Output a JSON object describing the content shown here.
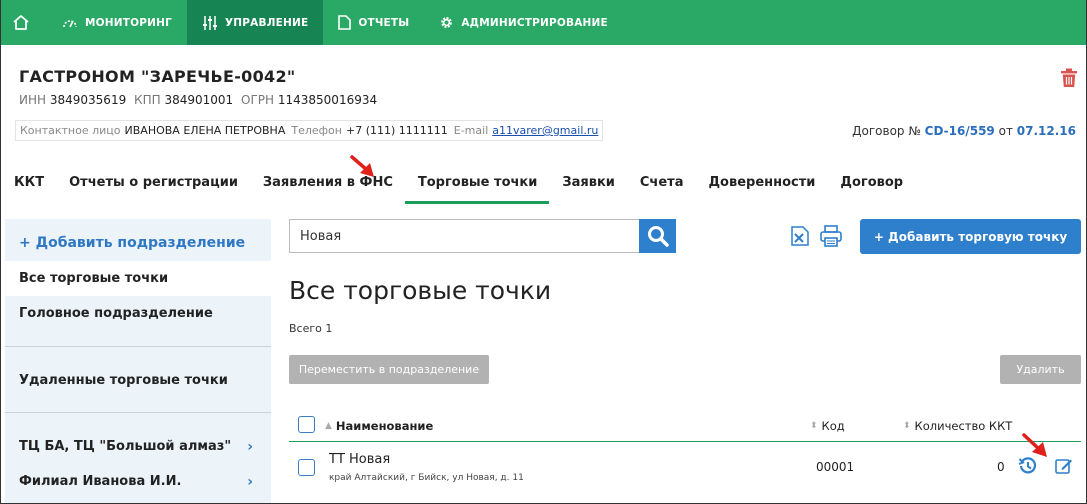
{
  "nav": {
    "items": [
      {
        "label": "МОНИТОРИНГ",
        "icon": "gauge-icon"
      },
      {
        "label": "УПРАВЛЕНИЕ",
        "icon": "sliders-icon",
        "active": true
      },
      {
        "label": "ОТЧЕТЫ",
        "icon": "document-icon"
      },
      {
        "label": "АДМИНИСТРИРОВАНИЕ",
        "icon": "gear-icon"
      }
    ]
  },
  "company": {
    "title": "ГАСТРОНОМ \"ЗАРЕЧЬЕ-0042\"",
    "inn_label": "ИНН",
    "inn": "3849035619",
    "kpp_label": "КПП",
    "kpp": "384901001",
    "ogrn_label": "ОГРН",
    "ogrn": "1143850016934",
    "contact_label": "Контактное лицо",
    "contact": "ИВАНОВА ЕЛЕНА ПЕТРОВНА",
    "phone_label": "Телефон",
    "phone": "+7 (111) 1111111",
    "email_label": "E-mail",
    "email": "a11varer@gmail.ru",
    "contract_label": "Договор №",
    "contract_no": "CD-16/559",
    "contract_from": "от",
    "contract_date": "07.12.16"
  },
  "tabs": [
    {
      "label": "ККТ"
    },
    {
      "label": "Отчеты о регистрации"
    },
    {
      "label": "Заявления в ФНС"
    },
    {
      "label": "Торговые точки",
      "active": true
    },
    {
      "label": "Заявки"
    },
    {
      "label": "Счета"
    },
    {
      "label": "Доверенности"
    },
    {
      "label": "Договор"
    }
  ],
  "sidebar": {
    "add_label": "+ Добавить подразделение",
    "all_points": "Все торговые точки",
    "head_division": "Головное подразделение",
    "deleted_points": "Удаленные торговые точки",
    "divisions": [
      {
        "label": "ТЦ БА, ТЦ \"Большой алмаз\""
      },
      {
        "label": "Филиал Иванова И.И."
      }
    ]
  },
  "main": {
    "search_value": "Новая",
    "add_button": "+ Добавить торговую точку",
    "title": "Все торговые точки",
    "total": "Всего 1",
    "move_button": "Переместить в подразделение",
    "delete_button": "Удалить",
    "columns": {
      "name": "Наименование",
      "code": "Код",
      "count": "Количество ККТ"
    },
    "rows": [
      {
        "name": "ТТ Новая",
        "address": "край Алтайский, г Бийск, ул Новая, д. 11",
        "code": "00001",
        "count": "0"
      }
    ]
  },
  "colors": {
    "nav_bg": "#2aa865",
    "nav_active": "#178553",
    "accent": "#2e7fcc",
    "tab_underline": "#1c9e5b"
  }
}
